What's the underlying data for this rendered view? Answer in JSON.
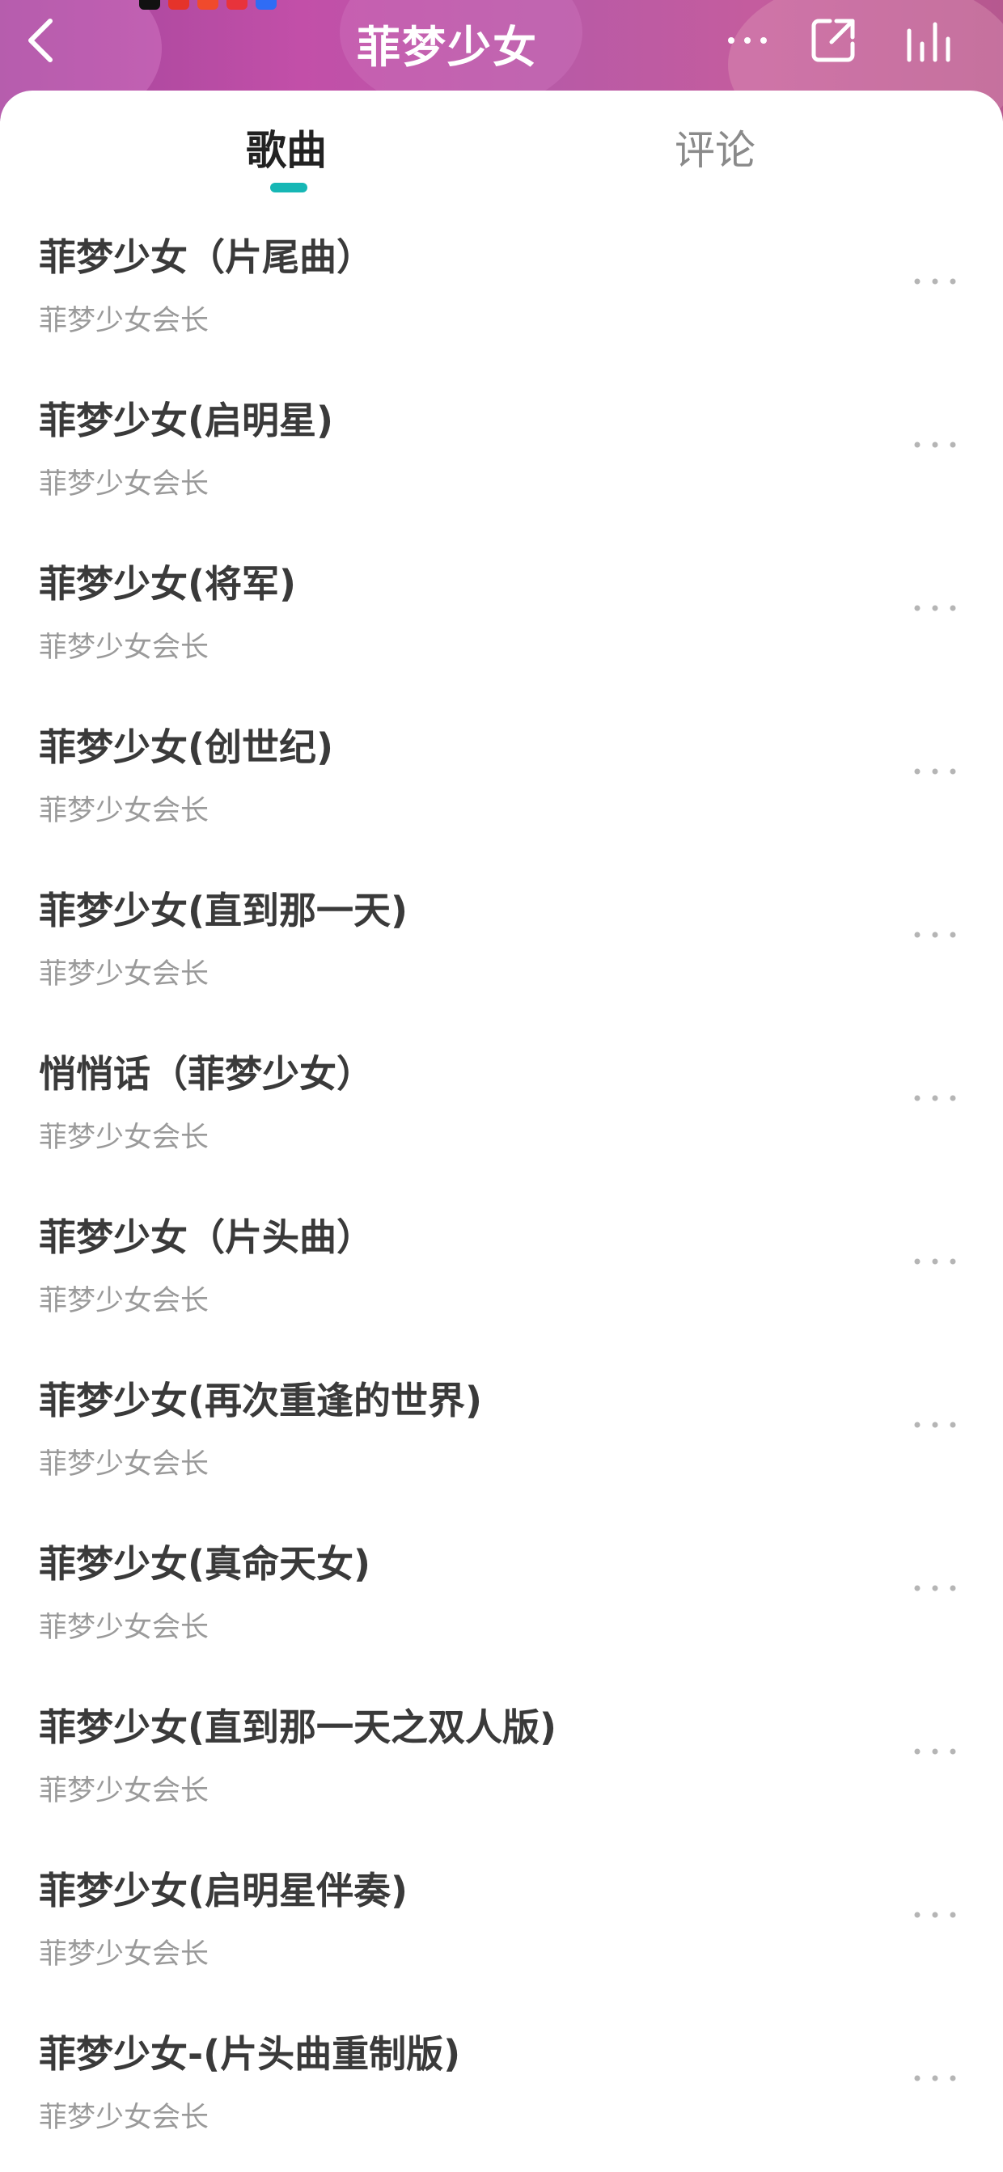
{
  "header": {
    "title": "菲梦少女",
    "back_icon": "chevron-left-icon",
    "more_icon": "more-horizontal-icon",
    "share_icon": "share-external-icon",
    "equalizer_icon": "equalizer-icon"
  },
  "tabs": [
    {
      "label": "歌曲",
      "active": true
    },
    {
      "label": "评论",
      "active": false
    }
  ],
  "colors": {
    "accent": "#16b7b5",
    "header_bg": "#b44fa3",
    "title_text": "#3a3a3a",
    "artist_text": "#9a9a9a"
  },
  "songs": [
    {
      "title": "菲梦少女（片尾曲）",
      "artist": "菲梦少女会长"
    },
    {
      "title": "菲梦少女(启明星)",
      "artist": "菲梦少女会长"
    },
    {
      "title": "菲梦少女(将军)",
      "artist": "菲梦少女会长"
    },
    {
      "title": "菲梦少女(创世纪)",
      "artist": "菲梦少女会长"
    },
    {
      "title": "菲梦少女(直到那一天)",
      "artist": "菲梦少女会长"
    },
    {
      "title": "悄悄话（菲梦少女）",
      "artist": "菲梦少女会长"
    },
    {
      "title": "菲梦少女（片头曲）",
      "artist": "菲梦少女会长"
    },
    {
      "title": "菲梦少女(再次重逢的世界)",
      "artist": "菲梦少女会长"
    },
    {
      "title": "菲梦少女(真命天女)",
      "artist": "菲梦少女会长"
    },
    {
      "title": "菲梦少女(直到那一天之双人版)",
      "artist": "菲梦少女会长"
    },
    {
      "title": "菲梦少女(启明星伴奏)",
      "artist": "菲梦少女会长"
    },
    {
      "title": "菲梦少女-(片头曲重制版)",
      "artist": "菲梦少女会长"
    }
  ]
}
